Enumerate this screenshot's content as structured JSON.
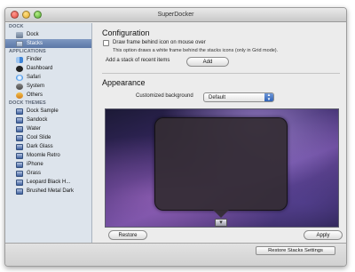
{
  "window": {
    "title": "SuperDocker"
  },
  "sidebar": {
    "sections": [
      {
        "label": "DOCK",
        "items": [
          {
            "label": "Dock",
            "icon": "dock-icon",
            "selected": false
          },
          {
            "label": "Stacks",
            "icon": "stacks-icon",
            "selected": true
          }
        ]
      },
      {
        "label": "APPLICATIONS",
        "items": [
          {
            "label": "Finder",
            "icon": "finder-icon"
          },
          {
            "label": "Dashboard",
            "icon": "dashboard-icon"
          },
          {
            "label": "Safari",
            "icon": "safari-icon"
          },
          {
            "label": "System",
            "icon": "system-icon"
          },
          {
            "label": "Others",
            "icon": "others-icon"
          }
        ]
      },
      {
        "label": "DOCK THEMES",
        "items": [
          {
            "label": "Dock Sample",
            "icon": "theme-icon"
          },
          {
            "label": "Sandock",
            "icon": "theme-icon"
          },
          {
            "label": "Water",
            "icon": "theme-icon"
          },
          {
            "label": "Cool Slide",
            "icon": "theme-icon"
          },
          {
            "label": "Dark Glass",
            "icon": "theme-icon"
          },
          {
            "label": "Moomle Retro",
            "icon": "theme-icon"
          },
          {
            "label": "iPhone",
            "icon": "theme-icon"
          },
          {
            "label": "Grass",
            "icon": "theme-icon"
          },
          {
            "label": "Leopard Black H...",
            "icon": "theme-icon"
          },
          {
            "label": "Brushed Metal Dark",
            "icon": "theme-icon"
          }
        ]
      }
    ]
  },
  "configuration": {
    "heading": "Configuration",
    "draw_frame_label": "Draw frame behind icon on mouse over",
    "draw_frame_checked": false,
    "draw_frame_note": "This option draws a white frame behind the stacks icons (only in Grid mode).",
    "add_stack_label": "Add a stack of recent items",
    "add_button": "Add"
  },
  "appearance": {
    "heading": "Appearance",
    "background_label": "Customized background",
    "background_value": "Default",
    "restore_button": "Restore",
    "apply_button": "Apply"
  },
  "footer": {
    "restore_stacks_button": "Restore Stacks Settings"
  }
}
